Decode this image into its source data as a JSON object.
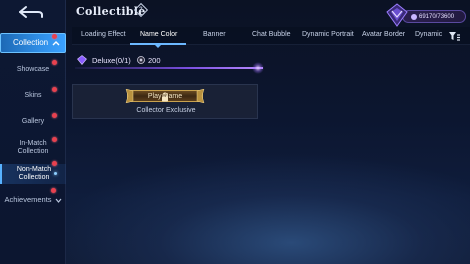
{
  "header": {
    "title": "Collectible",
    "currency_value": "69170/73600"
  },
  "sidebar": {
    "items": [
      {
        "label": "Collection"
      },
      {
        "label": "Showcase"
      },
      {
        "label": "Skins"
      },
      {
        "label": "Gallery"
      },
      {
        "label": "In-Match Collection"
      },
      {
        "label": "Non-Match Collection"
      },
      {
        "label": "Achievements"
      }
    ]
  },
  "tabs": [
    {
      "label": "Loading Effect"
    },
    {
      "label": "Name Color"
    },
    {
      "label": "Banner"
    },
    {
      "label": "Chat Bubble"
    },
    {
      "label": "Dynamic Portrait"
    },
    {
      "label": "Avatar Border"
    },
    {
      "label": "Dynamic"
    }
  ],
  "section": {
    "title": "Deluxe(0/1)",
    "points": "200"
  },
  "card": {
    "nameplate_text": "Play Name",
    "label": "Collector Exclusive"
  },
  "colors": {
    "accent": "#3aa1ff",
    "deluxe_purple": "#7a4fe0",
    "gold": "#c9a24e",
    "notification_red": "#e8414f"
  }
}
